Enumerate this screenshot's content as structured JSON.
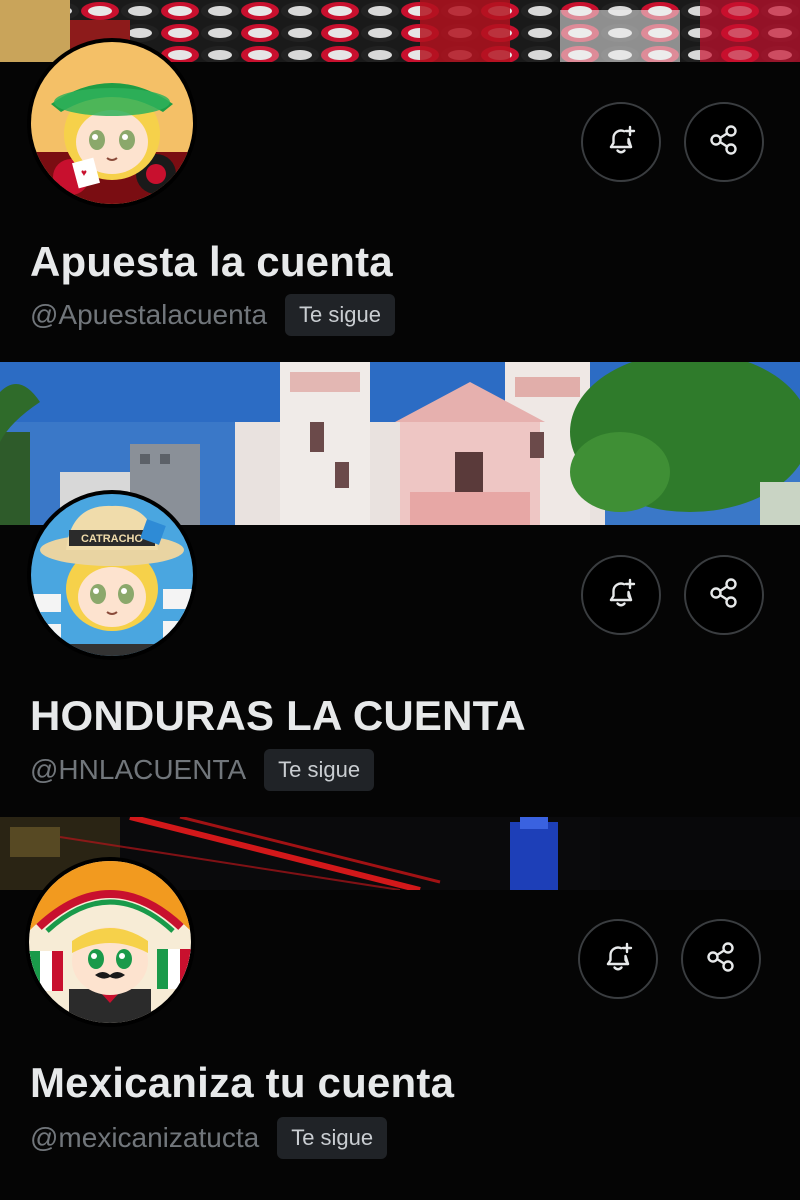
{
  "profiles": [
    {
      "display_name": "Apuesta la cuenta",
      "handle": "@Apuestalacuenta",
      "follows_you_label": "Te sigue",
      "banner_theme": "casino-chips",
      "avatar_theme": "casino"
    },
    {
      "display_name": "HONDURAS LA CUENTA",
      "handle": "@HNLACUENTA",
      "follows_you_label": "Te sigue",
      "banner_theme": "church-plaza",
      "avatar_theme": "honduras"
    },
    {
      "display_name": "Mexicaniza tu cuenta",
      "handle": "@mexicanizatucta",
      "follows_you_label": "Te sigue",
      "banner_theme": "night-lights",
      "avatar_theme": "mexico"
    }
  ],
  "avatar_texts": {
    "honduras_hat_band": "CATRACHO"
  },
  "icons": {
    "notify": "bell-plus-icon",
    "share": "share-icon"
  },
  "colors": {
    "background": "#000000",
    "name": "#e7e9ea",
    "handle": "#71767b",
    "badge_bg": "#202327",
    "button_border": "#3a3d40"
  }
}
